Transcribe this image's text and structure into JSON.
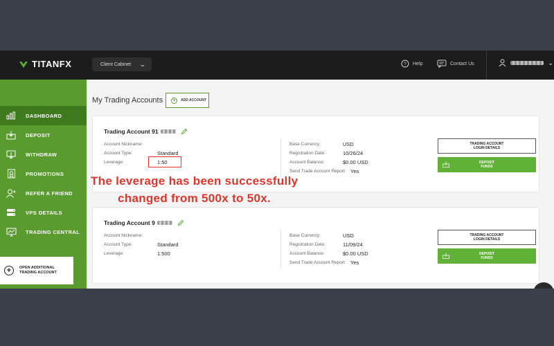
{
  "header": {
    "logo_text": "TITANFX",
    "cabinet_label": "Client Cabinet",
    "help_label": "Help",
    "contact_label": "Contact Us"
  },
  "sidebar": {
    "items": [
      {
        "label": "DASHBOARD",
        "icon": "chart-bars-icon",
        "active": true
      },
      {
        "label": "DEPOSIT",
        "icon": "deposit-icon",
        "active": false
      },
      {
        "label": "WITHDRAW",
        "icon": "withdraw-icon",
        "active": false
      },
      {
        "label": "PROMOTIONS",
        "icon": "promotions-icon",
        "active": false
      },
      {
        "label": "REFER A FRIEND",
        "icon": "refer-icon",
        "active": false
      },
      {
        "label": "VPS DETAILS",
        "icon": "server-icon",
        "active": false
      },
      {
        "label": "TRADING CENTRAL",
        "icon": "monitor-chart-icon",
        "active": false
      }
    ],
    "open_account_line1": "OPEN ADDITIONAL",
    "open_account_line2": "TRADING ACCOUNT"
  },
  "main": {
    "title": "My Trading Accounts",
    "add_account_label": "ADD ACCOUNT",
    "accounts": [
      {
        "name": "Trading Account 91",
        "nickname_label": "Account Nickname:",
        "type_label": "Account Type:",
        "type_value": "Standard",
        "leverage_label": "Leverage:",
        "leverage_value": "1:50",
        "currency_label": "Base Currency:",
        "currency_value": "USD",
        "reg_label": "Registration Date:",
        "reg_value": "10/26/24",
        "balance_label": "Account Balance:",
        "balance_value": "$0.00 USD",
        "report_label": "Send Trade Account Report:",
        "report_value": "Yes",
        "login_btn_line1": "TRADING ACCOUNT",
        "login_btn_line2": "LOGIN DETAILS",
        "deposit_btn_line1": "DEPOSIT",
        "deposit_btn_line2": "FUNDS"
      },
      {
        "name": "Trading Account 9",
        "nickname_label": "Account Nickname:",
        "type_label": "Account Type:",
        "type_value": "Standard",
        "leverage_label": "Leverage:",
        "leverage_value": "1:500",
        "currency_label": "Base Currency:",
        "currency_value": "USD",
        "reg_label": "Registration Date:",
        "reg_value": "11/09/24",
        "balance_label": "Account Balance:",
        "balance_value": "$0.00 USD",
        "report_label": "Send Trade Account Report:",
        "report_value": "Yes",
        "login_btn_line1": "TRADING ACCOUNT",
        "login_btn_line2": "LOGIN DETAILS",
        "deposit_btn_line1": "DEPOSIT",
        "deposit_btn_line2": "FUNDS"
      }
    ]
  },
  "annotation": {
    "line1": "The leverage has been successfully",
    "line2": "changed from 500x to 50x."
  },
  "colors": {
    "brand_green": "#5a9b2f",
    "button_green": "#5fb236",
    "highlight_red": "#e0352b",
    "topbar": "#1c1c1c"
  }
}
